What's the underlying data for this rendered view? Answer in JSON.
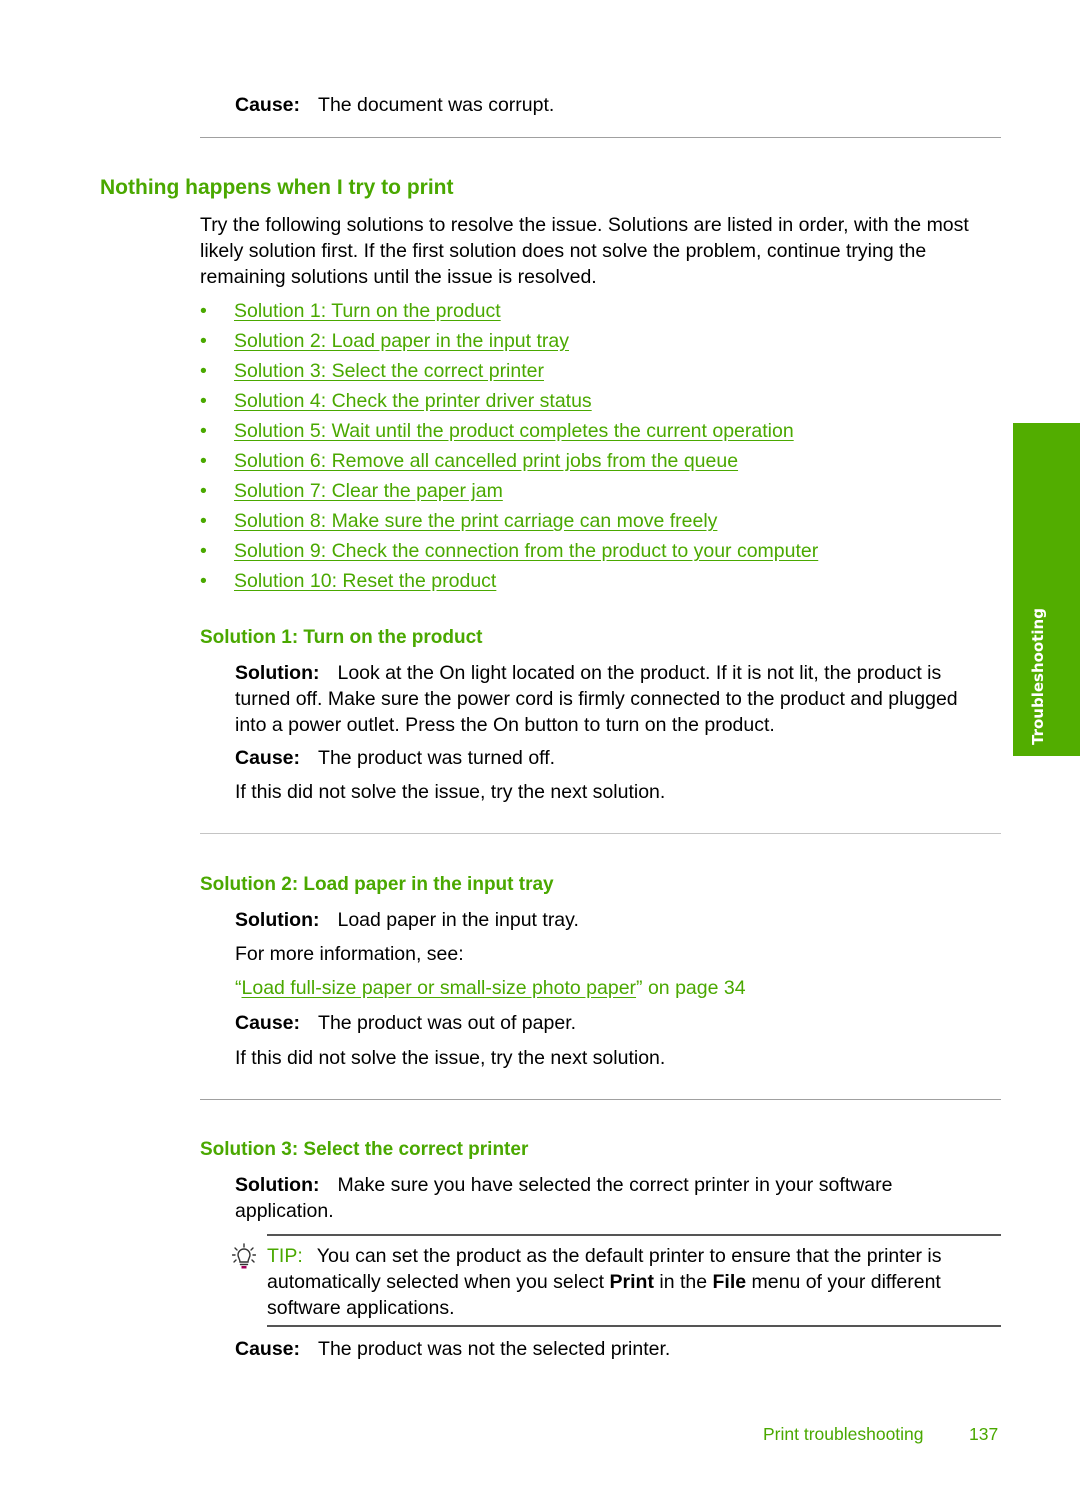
{
  "top_cause": {
    "label": "Cause:",
    "text": "The document was corrupt."
  },
  "section": {
    "title": "Nothing happens when I try to print",
    "intro": [
      "Try the following solutions to resolve the issue. Solutions are listed in order, with the most",
      "likely solution first. If the first solution does not solve the problem, continue trying the",
      "remaining solutions until the issue is resolved."
    ],
    "bullet_glyph": "•",
    "links": [
      "Solution 1: Turn on the product",
      "Solution 2: Load paper in the input tray",
      "Solution 3: Select the correct printer",
      "Solution 4: Check the printer driver status",
      "Solution 5: Wait until the product completes the current operation",
      "Solution 6: Remove all cancelled print jobs from the queue",
      "Solution 7: Clear the paper jam",
      "Solution 8: Make sure the print carriage can move freely",
      "Solution 9: Check the connection from the product to your computer",
      "Solution 10: Reset the product"
    ]
  },
  "solution1": {
    "title": "Solution 1: Turn on the product",
    "solution_label": "Solution:",
    "solution_lines": [
      "Look at the On light located on the product. If it is not lit, the product is",
      "turned off. Make sure the power cord is firmly connected to the product and plugged",
      "into a power outlet. Press the On button to turn on the product."
    ],
    "cause_label": "Cause:",
    "cause_text": "The product was turned off.",
    "next": "If this did not solve the issue, try the next solution."
  },
  "solution2": {
    "title": "Solution 2: Load paper in the input tray",
    "solution_label": "Solution:",
    "solution_text": "Load paper in the input tray.",
    "more_info": "For more information, see:",
    "ref_open_quote": "“",
    "ref_link": "Load full-size paper or small-size photo paper",
    "ref_suffix": "” on page 34",
    "cause_label": "Cause:",
    "cause_text": "The product was out of paper.",
    "next": "If this did not solve the issue, try the next solution."
  },
  "solution3": {
    "title": "Solution 3: Select the correct printer",
    "solution_label": "Solution:",
    "solution_lines": [
      "Make sure you have selected the correct printer in your software",
      "application."
    ],
    "tip": {
      "icon": "lightbulb-icon",
      "label": "TIP:",
      "line1": "You can set the product as the default printer to ensure that the printer is",
      "line2_a": "automatically selected when you select ",
      "line2_b": "Print",
      "line2_c": " in the ",
      "line2_d": "File",
      "line2_e": " menu of your different",
      "line3": "software applications."
    },
    "cause_label": "Cause:",
    "cause_text": "The product was not the selected printer."
  },
  "side_tab": {
    "label": "Troubleshooting",
    "color": "#52ad00"
  },
  "footer": {
    "section": "Print troubleshooting",
    "page": "137"
  },
  "colors": {
    "accent": "#4aa800",
    "text": "#000000",
    "divider": "#a0a0a0"
  }
}
